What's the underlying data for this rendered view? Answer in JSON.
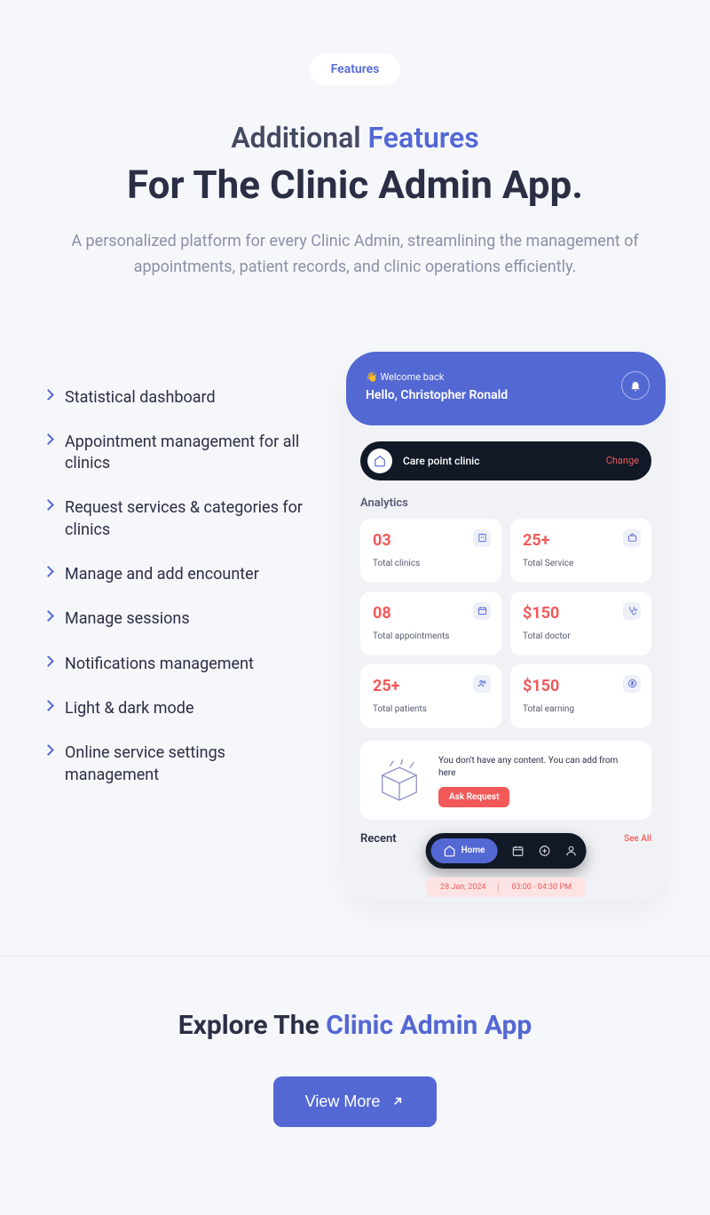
{
  "pill": "Features",
  "headline1_pre": "Additional ",
  "headline1_accent": "Features",
  "headline2": "For The Clinic Admin App.",
  "subhead": "A personalized platform for every Clinic Admin, streamlining the management of appointments, patient records, and clinic operations efficiently.",
  "features": [
    "Statistical dashboard",
    "Appointment management for all clinics",
    "Request services & categories for clinics",
    "Manage and add encounter",
    "Manage sessions",
    "Notifications management",
    "Light & dark mode",
    "Online service settings management"
  ],
  "phone": {
    "welcome_pre": "👋 ",
    "welcome": "Welcome back",
    "hello": "Hello, Christopher Ronald",
    "clinic_name": "Care point clinic",
    "change": "Change",
    "analytics_label": "Analytics",
    "cards": [
      {
        "num": "03",
        "lbl": "Total clinics"
      },
      {
        "num": "25+",
        "lbl": "Total Service"
      },
      {
        "num": "08",
        "lbl": "Total appointments"
      },
      {
        "num": "$150",
        "lbl": "Total doctor"
      },
      {
        "num": "25+",
        "lbl": "Total patients"
      },
      {
        "num": "$150",
        "lbl": "Total earning"
      }
    ],
    "empty_text": "You don't have any content. You can add from here",
    "ask_request": "Ask Request",
    "recent": "Recent",
    "see_all": "See All",
    "home": "Home",
    "appt_date": "28 Jan, 2024",
    "appt_time": "03:00 - 04:30 PM"
  },
  "explore_pre": "Explore The ",
  "explore_accent": "Clinic Admin App",
  "view_more": "View More"
}
